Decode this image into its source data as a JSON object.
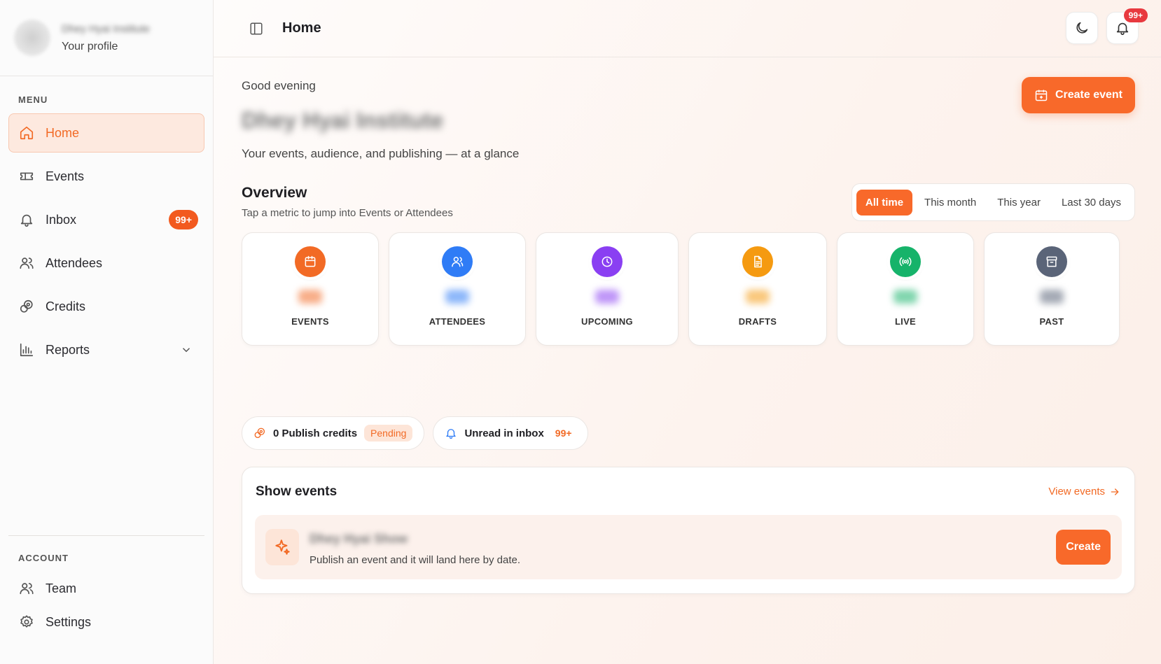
{
  "sidebar": {
    "profile": {
      "name": "Dhey Hyai Institute",
      "subtitle": "Your profile"
    },
    "menu_label": "MENU",
    "items": [
      {
        "label": "Home",
        "icon": "home-icon",
        "active": true
      },
      {
        "label": "Events",
        "icon": "ticket-icon"
      },
      {
        "label": "Inbox",
        "icon": "bell-icon",
        "badge": "99+"
      },
      {
        "label": "Attendees",
        "icon": "users-icon"
      },
      {
        "label": "Credits",
        "icon": "coins-icon"
      },
      {
        "label": "Reports",
        "icon": "bar-chart-icon",
        "expandable": true
      }
    ],
    "account_label": "ACCOUNT",
    "account_items": [
      {
        "label": "Team",
        "icon": "users-icon"
      },
      {
        "label": "Settings",
        "icon": "gear-icon"
      }
    ]
  },
  "topbar": {
    "title": "Home",
    "notification_badge": "99+"
  },
  "hero": {
    "greeting": "Good evening",
    "org_name": "Dhey Hyai Institute",
    "tagline": "Your events, audience, and publishing — at a glance",
    "create_button": "Create event"
  },
  "overview": {
    "title": "Overview",
    "subtitle": "Tap a metric to jump into Events or Attendees",
    "ranges": [
      "All time",
      "This month",
      "This year",
      "Last 30 days"
    ],
    "active_range": "All time",
    "metrics": [
      {
        "label": "EVENTS",
        "icon": "calendar-icon",
        "color": "#f26a25"
      },
      {
        "label": "ATTENDEES",
        "icon": "users-icon",
        "color": "#2f7cf6"
      },
      {
        "label": "UPCOMING",
        "icon": "clock-icon",
        "color": "#8a3ff2"
      },
      {
        "label": "DRAFTS",
        "icon": "document-icon",
        "color": "#f59a10"
      },
      {
        "label": "LIVE",
        "icon": "broadcast-icon",
        "color": "#16b36a"
      },
      {
        "label": "PAST",
        "icon": "archive-icon",
        "color": "#5a6478"
      }
    ]
  },
  "chips": {
    "credits_label": "0 Publish credits",
    "credits_status": "Pending",
    "inbox_label": "Unread in inbox",
    "inbox_count": "99+"
  },
  "show_events": {
    "title": "Show events",
    "view_link": "View events",
    "empty_title": "Dhey Hyai Show",
    "empty_sub": "Publish an event and it will land here by date.",
    "create_button": "Create"
  },
  "colors": {
    "accent": "#f8692a",
    "badge_red": "#e8393f"
  }
}
